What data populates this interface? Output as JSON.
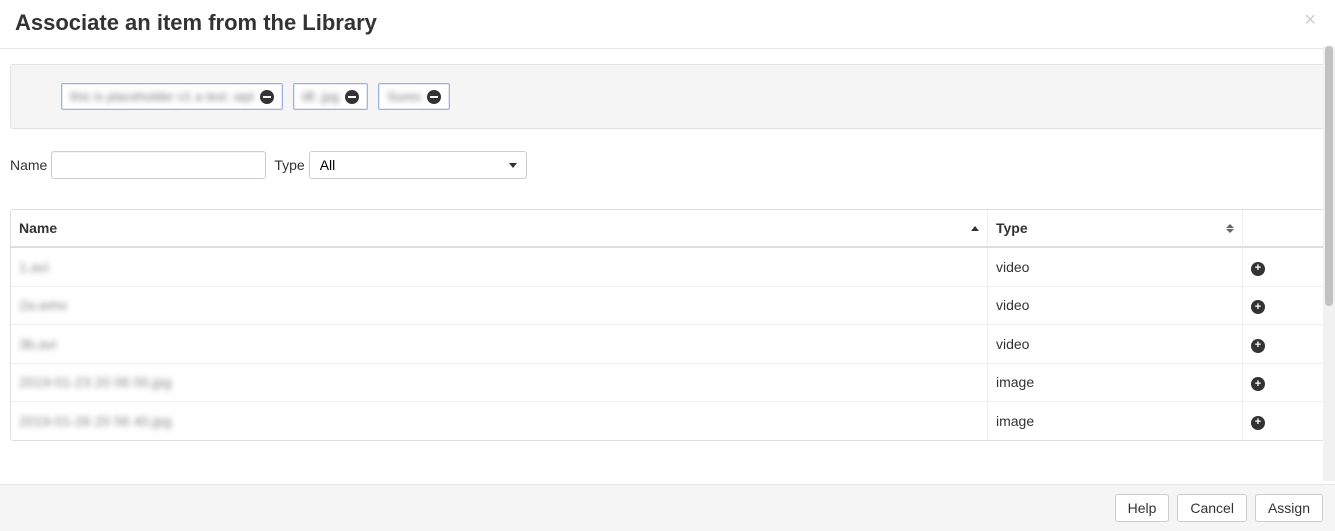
{
  "header": {
    "title": "Associate an item from the Library",
    "close": "×"
  },
  "selected": [
    {
      "label": "this is placeholder v1 a text .wpl"
    },
    {
      "label": "dll .jpg"
    },
    {
      "label": "Sures"
    }
  ],
  "filters": {
    "nameLabel": "Name",
    "nameValue": "",
    "typeLabel": "Type",
    "typeSelected": "All"
  },
  "table": {
    "columns": {
      "name": "Name",
      "type": "Type"
    },
    "rows": [
      {
        "name": "1.avi",
        "type": "video"
      },
      {
        "name": "2a.wmv",
        "type": "video"
      },
      {
        "name": "3b.avi",
        "type": "video"
      },
      {
        "name": "2019-01-23 20 06 00.jpg",
        "type": "image"
      },
      {
        "name": "2019-01-26 20 56 40.jpg",
        "type": "image"
      }
    ]
  },
  "footer": {
    "help": "Help",
    "cancel": "Cancel",
    "assign": "Assign"
  }
}
